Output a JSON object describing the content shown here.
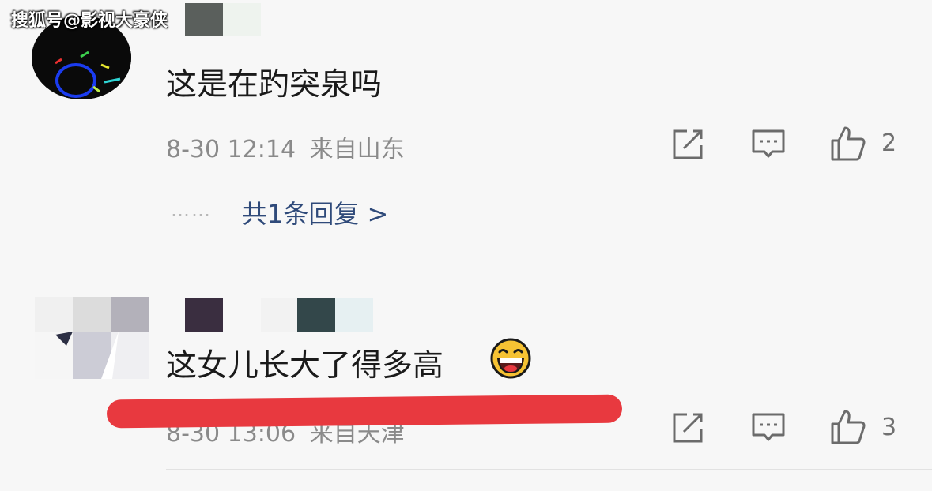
{
  "watermark": "搜狐号@影视大豪侠",
  "comments": [
    {
      "text": "这是在趵突泉吗",
      "time": "8-30 12:14",
      "location": "来自山东",
      "likes": "2",
      "reply_dots": "……",
      "replies_link": "共1条回复 >"
    },
    {
      "text": "这女儿长大了得多高",
      "emoji": "laughing-emoji",
      "time": "8-30 13:06",
      "location": "来自天津",
      "likes": "3"
    }
  ],
  "icons": {
    "share": "share-edit-icon",
    "reply": "comment-bubble-icon",
    "like": "thumbs-up-icon"
  },
  "annotation_color": "#e8393f"
}
